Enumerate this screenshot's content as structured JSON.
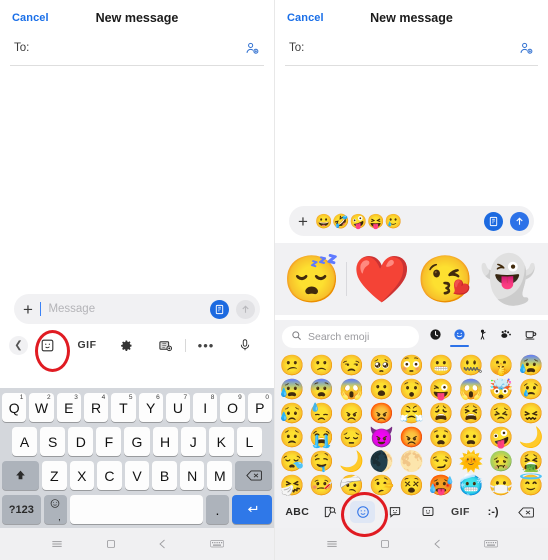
{
  "panels": [
    {
      "id": "left",
      "header": {
        "cancel_label": "Cancel",
        "title": "New message",
        "contact_icon": "add-contact-icon"
      },
      "to_field": {
        "label": "To:",
        "value": ""
      },
      "compose": {
        "plus_icon": "plus-icon",
        "placeholder": "Message",
        "value": "",
        "digital_touch_icon": "digital-touch-icon",
        "send_icon": "send-arrow-icon",
        "send_enabled": false
      },
      "toolbar": {
        "back_icon": "chevron-left-icon",
        "items": [
          {
            "name": "sticker-icon",
            "label": "",
            "highlighted": true
          },
          {
            "name": "gif-icon",
            "label": "GIF",
            "highlighted": false
          },
          {
            "name": "gear-icon",
            "label": "",
            "highlighted": false
          },
          {
            "name": "camera-icon",
            "label": "",
            "highlighted": false
          },
          {
            "name": "more-icon",
            "label": "•••",
            "highlighted": false
          },
          {
            "name": "microphone-icon",
            "label": "",
            "highlighted": false
          }
        ]
      },
      "keyboard": {
        "row1": [
          {
            "key": "Q",
            "sup": "1"
          },
          {
            "key": "W",
            "sup": "2"
          },
          {
            "key": "E",
            "sup": "3"
          },
          {
            "key": "R",
            "sup": "4"
          },
          {
            "key": "T",
            "sup": "5"
          },
          {
            "key": "Y",
            "sup": "6"
          },
          {
            "key": "U",
            "sup": "7"
          },
          {
            "key": "I",
            "sup": "8"
          },
          {
            "key": "O",
            "sup": "9"
          },
          {
            "key": "P",
            "sup": "0"
          }
        ],
        "row2": [
          {
            "key": "A"
          },
          {
            "key": "S"
          },
          {
            "key": "D"
          },
          {
            "key": "F"
          },
          {
            "key": "G"
          },
          {
            "key": "H"
          },
          {
            "key": "J"
          },
          {
            "key": "K"
          },
          {
            "key": "L"
          }
        ],
        "row3": [
          {
            "key": "Z"
          },
          {
            "key": "X"
          },
          {
            "key": "C"
          },
          {
            "key": "V"
          },
          {
            "key": "B"
          },
          {
            "key": "N"
          },
          {
            "key": "M"
          }
        ],
        "shift_icon": "shift-up-arrow-icon",
        "backspace_icon": "backspace-icon",
        "numeric_label": "?123",
        "emoji_key_icon": "emoji-comma-key-icon",
        "emoji_key_sub": ",",
        "space_label": "",
        "period_label": ".",
        "enter_icon": "enter-return-icon"
      },
      "navbar": [
        {
          "name": "recents-icon",
          "glyph": "≡"
        },
        {
          "name": "home-icon",
          "glyph": "▢"
        },
        {
          "name": "back-icon",
          "glyph": "◁"
        },
        {
          "name": "keyboard-hide-icon",
          "glyph": "keyboard"
        }
      ]
    },
    {
      "id": "right",
      "header": {
        "cancel_label": "Cancel",
        "title": "New message",
        "contact_icon": "add-contact-icon"
      },
      "to_field": {
        "label": "To:",
        "value": ""
      },
      "compose": {
        "plus_icon": "plus-icon",
        "placeholder": "",
        "value": "😀🤣🤪😝🥲",
        "digital_touch_icon": "digital-touch-icon",
        "send_icon": "send-arrow-icon",
        "send_enabled": true
      },
      "sticker_preview": [
        {
          "name": "sleeping-face-sticker",
          "glyph": "😴"
        },
        {
          "name": "sleeping-heart-sticker",
          "glyph": "❤️"
        },
        {
          "name": "kissing-sleepy-face-sticker",
          "glyph": "😘"
        },
        {
          "name": "ghost-sticker",
          "glyph": "👻"
        }
      ],
      "emoji_search": {
        "icon": "search-icon",
        "placeholder": "Search emoji"
      },
      "emoji_categories": [
        {
          "name": "recent-category-icon",
          "glyph": "🕐",
          "active": false
        },
        {
          "name": "smileys-category-icon",
          "glyph": "🙂",
          "active": true
        },
        {
          "name": "people-category-icon",
          "glyph": "person",
          "active": false
        },
        {
          "name": "animals-category-icon",
          "glyph": "paw",
          "active": false
        },
        {
          "name": "food-category-icon",
          "glyph": "cup",
          "active": false
        },
        {
          "name": "travel-category-icon",
          "glyph": "partial",
          "active": false
        }
      ],
      "emoji_grid": [
        "😕",
        "🙁",
        "😒",
        "🥺",
        "😳",
        "😬",
        "🤐",
        "🤫",
        "😰",
        "😰",
        "😨",
        "😱",
        "😮",
        "😯",
        "😜",
        "😱",
        "🤯",
        "😢",
        "😥",
        "😓",
        "😠",
        "😡",
        "😤",
        "😩",
        "😫",
        "😣",
        "😖",
        "😟",
        "😭",
        "😔",
        "😈",
        "😡",
        "😧",
        "😦",
        "🤪",
        "🌙",
        "😪",
        "🤤",
        "🌙",
        "🌒",
        "🌕",
        "😏",
        "🌞",
        "🤢",
        "🤮",
        "🤧",
        "🤒",
        "🤕",
        "🤥",
        "😵",
        "🥵",
        "🥶",
        "😷",
        "😇"
      ],
      "emoji_bottom_bar": [
        {
          "name": "abc-key",
          "label": "ABC",
          "highlighted": false
        },
        {
          "name": "sticker-search-icon",
          "label": "",
          "highlighted": false
        },
        {
          "name": "emoji-smiley-icon",
          "label": "",
          "highlighted": true
        },
        {
          "name": "sticker-face-icon",
          "label": "",
          "highlighted": false
        },
        {
          "name": "avatar-sticker-icon",
          "label": "",
          "highlighted": false
        },
        {
          "name": "gif-key",
          "label": "GIF",
          "highlighted": false
        },
        {
          "name": "emoticon-key",
          "label": ":-)",
          "highlighted": false
        },
        {
          "name": "backspace-icon",
          "label": "",
          "highlighted": false
        }
      ],
      "navbar": [
        {
          "name": "recents-icon",
          "glyph": "≡"
        },
        {
          "name": "home-icon",
          "glyph": "▢"
        },
        {
          "name": "back-icon",
          "glyph": "◁"
        },
        {
          "name": "keyboard-hide-icon",
          "glyph": "keyboard"
        }
      ]
    }
  ],
  "annotations": {
    "highlight_color": "#e01b22",
    "left_ring_target": "sticker-icon",
    "right_ring_target": "emoji-smiley-icon"
  }
}
